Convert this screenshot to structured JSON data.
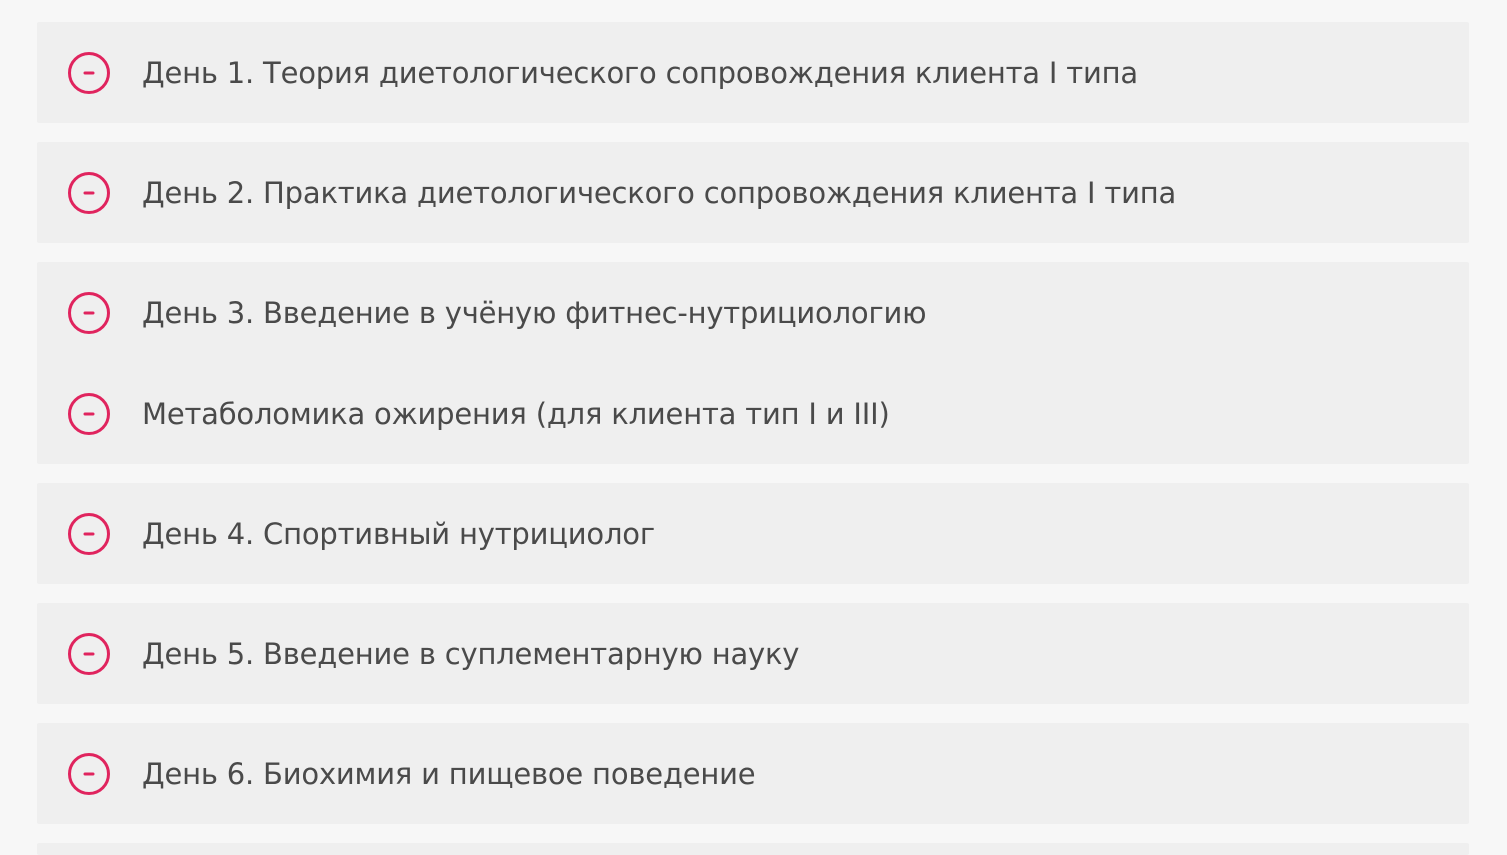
{
  "theme": {
    "accent": "#e0245e",
    "panel_bg": "#efefef",
    "page_bg": "#f7f7f7",
    "text": "#4a4a4a"
  },
  "accordion": {
    "icon": "collapse-minus-circle-icon",
    "items": [
      {
        "label": "День 1. Теория диетологического сопровождения клиента I типа"
      },
      {
        "label": "День 2. Практика диетологического сопровождения клиента I типа"
      },
      {
        "label": "День 3. Введение в учёную фитнес-нутрициологию"
      },
      {
        "label": "Метаболомика ожирения (для клиента тип I и III)"
      },
      {
        "label": "День 4. Спортивный нутрициолог"
      },
      {
        "label": "День 5. Введение в суплементарную науку"
      },
      {
        "label": "День 6. Биохимия и пищевое поведение"
      }
    ]
  }
}
